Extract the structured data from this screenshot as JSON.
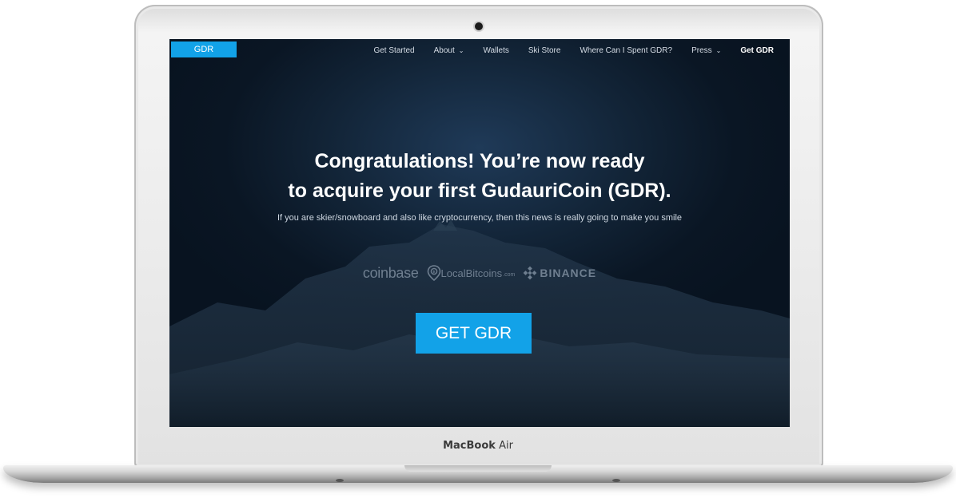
{
  "device": {
    "label_bold": "MacBook",
    "label_light": "Air"
  },
  "site": {
    "logo": "GDR",
    "nav": {
      "items": [
        {
          "label": "Get Started",
          "dropdown": false
        },
        {
          "label": "About",
          "dropdown": true
        },
        {
          "label": "Wallets",
          "dropdown": false
        },
        {
          "label": "Ski Store",
          "dropdown": false
        },
        {
          "label": "Where Can I Spent GDR?",
          "dropdown": false
        },
        {
          "label": "Press",
          "dropdown": true
        }
      ],
      "highlight": "Get GDR",
      "dropdown_icon": "chevron-down-icon"
    },
    "hero": {
      "headline_line1": "Congratulations! You’re now ready",
      "headline_line2": "to acquire your first GudauriCoin (GDR).",
      "subtitle": "If you are skier/snowboard and also like cryptocurrency, then this news is really going to make you smile",
      "partners": {
        "coinbase": "coinbase",
        "localbitcoins": "LocalBitcoins",
        "localbitcoins_domain": ".com",
        "binance": "BINANCE"
      },
      "cta": "GET GDR"
    },
    "colors": {
      "accent": "#12a2e8",
      "background": "#0a1624"
    }
  }
}
